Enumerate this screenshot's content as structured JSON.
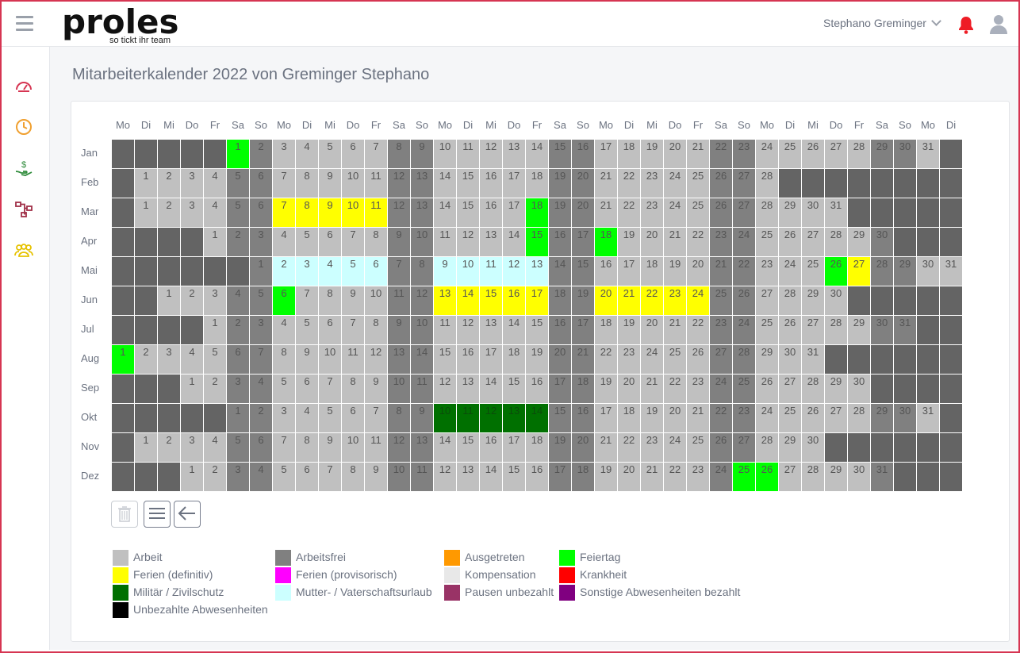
{
  "app": {
    "logo_text": "proles",
    "logo_tagline": "so tickt ihr team"
  },
  "header": {
    "user_name": "Stephano Greminger"
  },
  "sidebar": {
    "icons": [
      "dashboard-icon",
      "clock-icon",
      "money-hand-icon",
      "org-chart-icon",
      "team-icon"
    ]
  },
  "page": {
    "title": "Mitarbeiterkalender 2022 von Greminger Stephano"
  },
  "calendar": {
    "weekday_headers": [
      "Mo",
      "Di",
      "Mi",
      "Do",
      "Fr",
      "Sa",
      "So",
      "Mo",
      "Di",
      "Mi",
      "Do",
      "Fr",
      "Sa",
      "So",
      "Mo",
      "Di",
      "Mi",
      "Do",
      "Fr",
      "Sa",
      "So",
      "Mo",
      "Di",
      "Mi",
      "Do",
      "Fr",
      "Sa",
      "So",
      "Mo",
      "Di",
      "Mi",
      "Do",
      "Fr",
      "Sa",
      "So",
      "Mo",
      "Di"
    ],
    "months": [
      {
        "label": "Jan",
        "offset": 5,
        "days": 31,
        "special": {
          "1": "feiertag"
        }
      },
      {
        "label": "Feb",
        "offset": 1,
        "days": 28,
        "special": {}
      },
      {
        "label": "Mar",
        "offset": 1,
        "days": 31,
        "special": {
          "7": "ferien",
          "8": "ferien",
          "9": "ferien",
          "10": "ferien",
          "11": "ferien",
          "18": "feiertag"
        }
      },
      {
        "label": "Apr",
        "offset": 4,
        "days": 30,
        "special": {
          "15": "feiertag",
          "18": "feiertag"
        }
      },
      {
        "label": "Mai",
        "offset": 6,
        "days": 31,
        "special": {
          "2": "mutter",
          "3": "mutter",
          "4": "mutter",
          "5": "mutter",
          "6": "mutter",
          "9": "mutter",
          "10": "mutter",
          "11": "mutter",
          "12": "mutter",
          "13": "mutter",
          "26": "feiertag",
          "27": "ferien"
        }
      },
      {
        "label": "Jun",
        "offset": 2,
        "days": 30,
        "special": {
          "6": "feiertag",
          "13": "ferien",
          "14": "ferien",
          "15": "ferien",
          "16": "ferien",
          "17": "ferien",
          "20": "ferien",
          "21": "ferien",
          "22": "ferien",
          "23": "ferien",
          "24": "ferien"
        }
      },
      {
        "label": "Jul",
        "offset": 4,
        "days": 31,
        "special": {}
      },
      {
        "label": "Aug",
        "offset": 0,
        "days": 31,
        "special": {
          "1": "feiertag"
        }
      },
      {
        "label": "Sep",
        "offset": 3,
        "days": 30,
        "special": {}
      },
      {
        "label": "Okt",
        "offset": 5,
        "days": 31,
        "special": {
          "10": "militaer",
          "11": "militaer",
          "12": "militaer",
          "13": "militaer",
          "14": "militaer"
        }
      },
      {
        "label": "Nov",
        "offset": 1,
        "days": 30,
        "special": {}
      },
      {
        "label": "Dez",
        "offset": 3,
        "days": 31,
        "special": {
          "25": "feiertag",
          "26": "feiertag"
        }
      }
    ]
  },
  "buttons": [
    {
      "name": "delete-button",
      "icon": "trash-icon",
      "enabled": false
    },
    {
      "name": "list-button",
      "icon": "list-icon",
      "enabled": true
    },
    {
      "name": "back-button",
      "icon": "arrow-left-icon",
      "enabled": true
    }
  ],
  "colors": {
    "arbeit": "#c0c0c0",
    "arbeitsfrei": "#808080",
    "empty": "#646464",
    "ferien": "#ffff00",
    "feiertag": "#00ff00",
    "mutter": "#ccffff",
    "militaer": "#007000",
    "ausgetreten": "#ff9900",
    "ferien_prov": "#ff00ff",
    "kompensation": "#e8e8e8",
    "krankheit": "#ff0000",
    "pausen": "#993366",
    "sonstige": "#800080",
    "unbezahlt": "#000000"
  },
  "legend": [
    {
      "key": "arbeit",
      "label": "Arbeit",
      "color": "#c0c0c0"
    },
    {
      "key": "ferien",
      "label": "Ferien (definitiv)",
      "color": "#ffff00"
    },
    {
      "key": "militaer",
      "label": "Militär / Zivilschutz",
      "color": "#007000"
    },
    {
      "key": "unbezahlt",
      "label": "Unbezahlte Abwesenheiten",
      "color": "#000000"
    },
    {
      "key": "arbeitsfrei",
      "label": "Arbeitsfrei",
      "color": "#808080"
    },
    {
      "key": "ferien_prov",
      "label": "Ferien (provisorisch)",
      "color": "#ff00ff"
    },
    {
      "key": "mutter",
      "label": "Mutter- / Vaterschaftsurlaub",
      "color": "#ccffff"
    },
    {
      "key": "ausgetreten",
      "label": "Ausgetreten",
      "color": "#ff9900"
    },
    {
      "key": "kompensation",
      "label": "Kompensation",
      "color": "#e8e8e8"
    },
    {
      "key": "pausen",
      "label": "Pausen unbezahlt",
      "color": "#993366"
    },
    {
      "key": "feiertag",
      "label": "Feiertag",
      "color": "#00ff00"
    },
    {
      "key": "krankheit",
      "label": "Krankheit",
      "color": "#ff0000"
    },
    {
      "key": "sonstige",
      "label": "Sonstige Abwesenheiten bezahlt",
      "color": "#800080"
    }
  ]
}
